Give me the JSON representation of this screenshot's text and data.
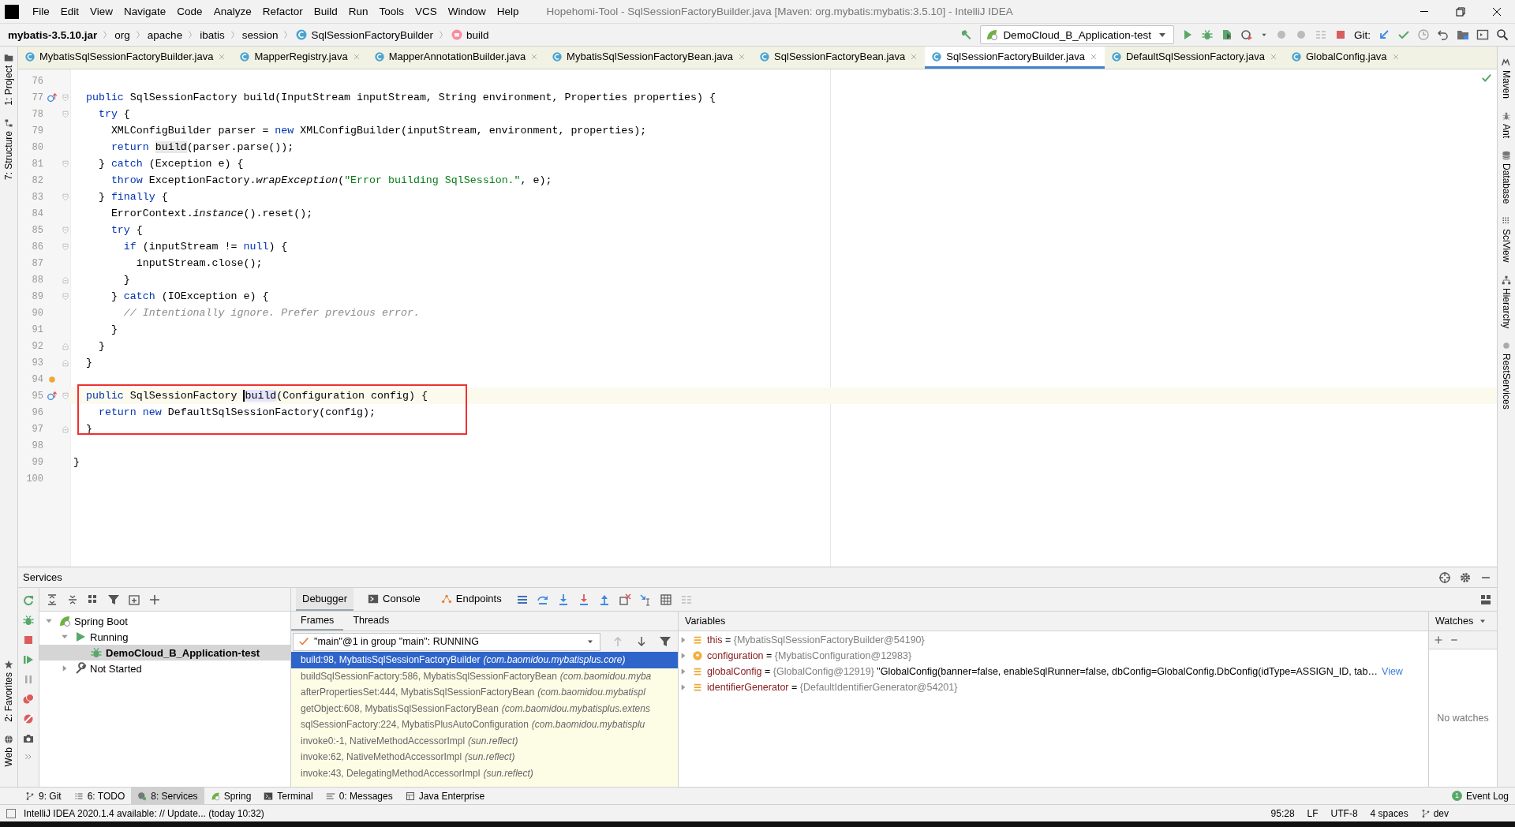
{
  "menu": [
    "File",
    "Edit",
    "View",
    "Navigate",
    "Code",
    "Analyze",
    "Refactor",
    "Build",
    "Run",
    "Tools",
    "VCS",
    "Window",
    "Help"
  ],
  "window_title": "Hopehomi-Tool - SqlSessionFactoryBuilder.java [Maven: org.mybatis:mybatis:3.5.10] - IntelliJ IDEA",
  "breadcrumbs": [
    {
      "label": "mybatis-3.5.10.jar",
      "kind": "jar"
    },
    {
      "label": "org",
      "kind": "package"
    },
    {
      "label": "apache",
      "kind": "package"
    },
    {
      "label": "ibatis",
      "kind": "package"
    },
    {
      "label": "session",
      "kind": "package"
    },
    {
      "label": "SqlSessionFactoryBuilder",
      "kind": "class"
    },
    {
      "label": "build",
      "kind": "method"
    }
  ],
  "run_config": "DemoCloud_B_Application-test",
  "vcs_label": "Git:",
  "left_tool_windows_top": [
    "1: Project",
    "7: Structure"
  ],
  "left_tool_windows_bottom": [
    "2: Favorites",
    "Web"
  ],
  "right_tool_windows": [
    "Maven",
    "Ant",
    "Database",
    "SciView",
    "Hierarchy",
    "RestServices"
  ],
  "tabs": [
    {
      "label": "MybatisSqlSessionFactoryBuilder.java",
      "selected": false
    },
    {
      "label": "MapperRegistry.java",
      "selected": false
    },
    {
      "label": "MapperAnnotationBuilder.java",
      "selected": false
    },
    {
      "label": "MybatisSqlSessionFactoryBean.java",
      "selected": false
    },
    {
      "label": "SqlSessionFactoryBean.java",
      "selected": false
    },
    {
      "label": "SqlSessionFactoryBuilder.java",
      "selected": true
    },
    {
      "label": "DefaultSqlSessionFactory.java",
      "selected": false
    },
    {
      "label": "GlobalConfig.java",
      "selected": false
    }
  ],
  "editor": {
    "lines": [
      {
        "number": "76",
        "fold": false,
        "current": false,
        "boxed": false
      },
      {
        "number": "77",
        "fold": true,
        "current": false,
        "boxed": false,
        "kind": "implements",
        "segments": [
          {
            "text": "  public",
            "kind": "kw"
          },
          {
            "text": " SqlSessionFactory build(InputStream inputStream, String environment, Properties properties) {",
            "kind": "plain"
          }
        ]
      },
      {
        "number": "78",
        "fold": true,
        "current": false,
        "boxed": false,
        "segments": [
          {
            "text": "    try",
            "kind": "kw"
          },
          {
            "text": " {",
            "kind": "plain"
          }
        ]
      },
      {
        "number": "79",
        "fold": false,
        "current": false,
        "boxed": false,
        "segments": [
          {
            "text": "      XMLConfigBuilder parser = ",
            "kind": "plain"
          },
          {
            "text": "new",
            "kind": "kw"
          },
          {
            "text": " XMLConfigBuilder(inputStream, environment, properties);",
            "kind": "plain"
          }
        ]
      },
      {
        "number": "80",
        "fold": false,
        "current": false,
        "boxed": false,
        "segments": [
          {
            "text": "      return ",
            "kind": "kw"
          },
          {
            "text": "build",
            "kind": "usage"
          },
          {
            "text": "(parser.parse());",
            "kind": "plain"
          }
        ]
      },
      {
        "number": "81",
        "fold": true,
        "current": false,
        "boxed": false,
        "segments": [
          {
            "text": "    } ",
            "kind": "plain"
          },
          {
            "text": "catch",
            "kind": "kw"
          },
          {
            "text": " (Exception e) {",
            "kind": "plain"
          }
        ]
      },
      {
        "number": "82",
        "fold": false,
        "current": false,
        "boxed": false,
        "segments": [
          {
            "text": "      throw",
            "kind": "kw"
          },
          {
            "text": " ExceptionFactory.",
            "kind": "plain"
          },
          {
            "text": "wrapException",
            "kind": "static"
          },
          {
            "text": "(",
            "kind": "plain"
          },
          {
            "text": "\"Error building SqlSession.\"",
            "kind": "str"
          },
          {
            "text": ", e);",
            "kind": "plain"
          }
        ]
      },
      {
        "number": "83",
        "fold": true,
        "current": false,
        "boxed": false,
        "segments": [
          {
            "text": "    } ",
            "kind": "plain"
          },
          {
            "text": "finally",
            "kind": "kw"
          },
          {
            "text": " {",
            "kind": "plain"
          }
        ]
      },
      {
        "number": "84",
        "fold": false,
        "current": false,
        "boxed": false,
        "segments": [
          {
            "text": "      ErrorContext.",
            "kind": "plain"
          },
          {
            "text": "instance",
            "kind": "static"
          },
          {
            "text": "().reset();",
            "kind": "plain"
          }
        ]
      },
      {
        "number": "85",
        "fold": true,
        "current": false,
        "boxed": false,
        "segments": [
          {
            "text": "      try",
            "kind": "kw"
          },
          {
            "text": " {",
            "kind": "plain"
          }
        ]
      },
      {
        "number": "86",
        "fold": true,
        "current": false,
        "boxed": false,
        "segments": [
          {
            "text": "        if",
            "kind": "kw"
          },
          {
            "text": " (inputStream != ",
            "kind": "plain"
          },
          {
            "text": "null",
            "kind": "kw"
          },
          {
            "text": ") {",
            "kind": "plain"
          }
        ]
      },
      {
        "number": "87",
        "fold": false,
        "current": false,
        "boxed": false,
        "segments": [
          {
            "text": "          inputStream.close();",
            "kind": "plain"
          }
        ]
      },
      {
        "number": "88",
        "fold": true,
        "current": false,
        "boxed": false,
        "segments": [
          {
            "text": "        }",
            "kind": "plain"
          }
        ]
      },
      {
        "number": "89",
        "fold": true,
        "current": false,
        "boxed": false,
        "segments": [
          {
            "text": "      } ",
            "kind": "plain"
          },
          {
            "text": "catch",
            "kind": "kw"
          },
          {
            "text": " (IOException e) {",
            "kind": "plain"
          }
        ]
      },
      {
        "number": "90",
        "fold": false,
        "current": false,
        "boxed": false,
        "segments": [
          {
            "text": "        // Intentionally ignore. Prefer previous error.",
            "kind": "comment"
          }
        ]
      },
      {
        "number": "91",
        "fold": false,
        "current": false,
        "boxed": false,
        "segments": [
          {
            "text": "      }",
            "kind": "plain"
          }
        ]
      },
      {
        "number": "92",
        "fold": true,
        "current": false,
        "boxed": false,
        "segments": [
          {
            "text": "    }",
            "kind": "plain"
          }
        ]
      },
      {
        "number": "93",
        "fold": true,
        "current": false,
        "boxed": false,
        "segments": [
          {
            "text": "  }",
            "kind": "plain"
          }
        ]
      },
      {
        "number": "94",
        "fold": false,
        "current": false,
        "boxed": false,
        "kind": "bulb"
      },
      {
        "number": "95",
        "fold": true,
        "current": true,
        "boxed": true,
        "kind": "implements",
        "segments": [
          {
            "text": "  public",
            "kind": "kw"
          },
          {
            "text": " SqlSessionFactory ",
            "kind": "plain"
          },
          {
            "text": "build",
            "kind": "caret-usage"
          },
          {
            "text": "(Configuration config) {",
            "kind": "plain"
          }
        ]
      },
      {
        "number": "96",
        "fold": false,
        "current": false,
        "boxed": true,
        "segments": [
          {
            "text": "    return new",
            "kind": "kw"
          },
          {
            "text": " DefaultSqlSessionFactory(config);",
            "kind": "plain"
          }
        ]
      },
      {
        "number": "97",
        "fold": true,
        "current": false,
        "boxed": true,
        "segments": [
          {
            "text": "  }",
            "kind": "plain"
          }
        ]
      },
      {
        "number": "98",
        "fold": false,
        "current": false,
        "boxed": false
      },
      {
        "number": "99",
        "fold": false,
        "current": false,
        "boxed": false,
        "segments": [
          {
            "text": "}",
            "kind": "plain"
          }
        ]
      },
      {
        "number": "100",
        "fold": false,
        "current": false,
        "boxed": false
      }
    ]
  },
  "services": {
    "title": "Services",
    "tree": [
      {
        "label": "Spring Boot",
        "kind": "group",
        "expanded": true,
        "selected": false,
        "children": [
          {
            "label": "Running",
            "kind": "running",
            "expanded": true,
            "selected": false,
            "children": [
              {
                "label": "DemoCloud_B_Application-test",
                "kind": "app",
                "selected": true
              }
            ]
          },
          {
            "label": "Not Started",
            "kind": "stopped",
            "expanded": false,
            "selected": false
          }
        ]
      }
    ],
    "debugger": {
      "tabs": [
        {
          "label": "Debugger",
          "selected": true
        },
        {
          "label": "Console",
          "selected": false
        },
        {
          "label": "Endpoints",
          "selected": false
        }
      ],
      "frame_tabs": [
        {
          "label": "Frames",
          "selected": true
        },
        {
          "label": "Threads",
          "selected": false
        }
      ],
      "thread": "\"main\"@1 in group \"main\": RUNNING",
      "frames": [
        {
          "location": "build:98, MybatisSqlSessionFactoryBuilder",
          "package": "(com.baomidou.mybatisplus.core)",
          "selected": true
        },
        {
          "location": "buildSqlSessionFactory:586, MybatisSqlSessionFactoryBean",
          "package": "(com.baomidou.myba",
          "selected": false
        },
        {
          "location": "afterPropertiesSet:444, MybatisSqlSessionFactoryBean",
          "package": "(com.baomidou.mybatispl",
          "selected": false
        },
        {
          "location": "getObject:608, MybatisSqlSessionFactoryBean",
          "package": "(com.baomidou.mybatisplus.extens",
          "selected": false
        },
        {
          "location": "sqlSessionFactory:224, MybatisPlusAutoConfiguration",
          "package": "(com.baomidou.mybatisplu",
          "selected": false
        },
        {
          "location": "invoke0:-1, NativeMethodAccessorImpl",
          "package": "(sun.reflect)",
          "selected": false
        },
        {
          "location": "invoke:62, NativeMethodAccessorImpl",
          "package": "(sun.reflect)",
          "selected": false
        },
        {
          "location": "invoke:43, DelegatingMethodAccessorImpl",
          "package": "(sun.reflect)",
          "selected": false
        }
      ],
      "variables_title": "Variables",
      "variables": [
        {
          "kind": "field",
          "name": "this",
          "sign": "=",
          "value": "{MybatisSqlSessionFactoryBuilder@54190}"
        },
        {
          "kind": "parameter",
          "name": "configuration",
          "sign": "=",
          "value": "{MybatisConfiguration@12983}"
        },
        {
          "kind": "field",
          "name": "globalConfig",
          "sign": "=",
          "value": "{GlobalConfig@12919}",
          "detail": "\"GlobalConfig(banner=false, enableSqlRunner=false, dbConfig=GlobalConfig.DbConfig(idType=ASSIGN_ID, tab…",
          "link": "View"
        },
        {
          "kind": "field",
          "name": "identifierGenerator",
          "sign": "=",
          "value": "{DefaultIdentifierGenerator@54201}"
        }
      ],
      "watches_title": "Watches",
      "watches_empty": "No watches"
    }
  },
  "tool_windows": [
    {
      "label": "9: Git",
      "selected": false
    },
    {
      "label": "6: TODO",
      "selected": false
    },
    {
      "label": "8: Services",
      "selected": true
    },
    {
      "label": "Spring",
      "selected": false
    },
    {
      "label": "Terminal",
      "selected": false
    },
    {
      "label": "0: Messages",
      "selected": false
    },
    {
      "label": "Java Enterprise",
      "selected": false
    }
  ],
  "event_log": {
    "label": "Event Log",
    "count": "1"
  },
  "status": {
    "message": "IntelliJ IDEA 2020.1.4 available: // Update... (today 10:32)",
    "position": "95:28",
    "line_separator": "LF",
    "encoding": "UTF-8",
    "indent": "4 spaces",
    "branch": "dev"
  }
}
